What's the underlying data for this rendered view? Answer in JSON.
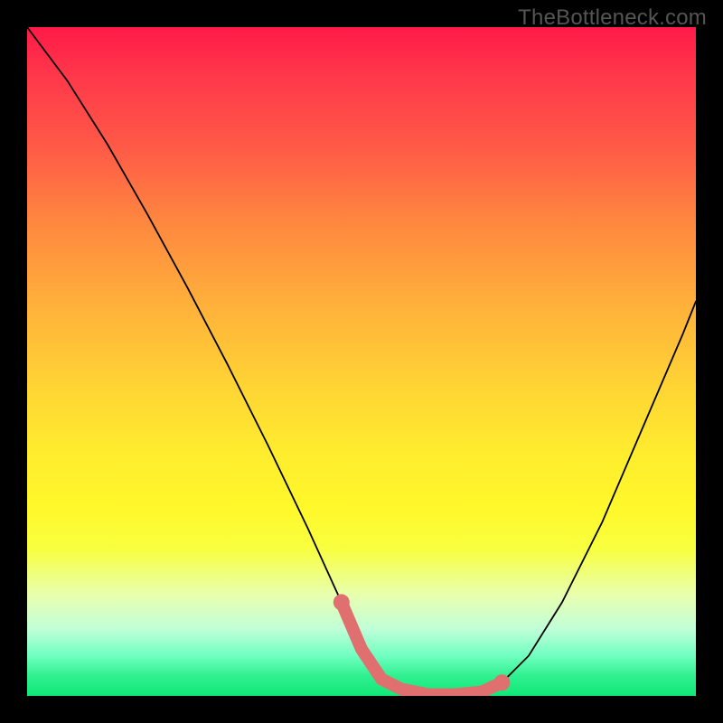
{
  "watermark": "TheBottleneck.com",
  "chart_data": {
    "type": "line",
    "title": "",
    "xlabel": "",
    "ylabel": "",
    "xlim": [
      0,
      100
    ],
    "ylim": [
      0,
      100
    ],
    "grid": false,
    "series": [
      {
        "name": "curve",
        "x": [
          0,
          6,
          12,
          18,
          24,
          30,
          36,
          42,
          47,
          50,
          53,
          56,
          60,
          64,
          68,
          71,
          75,
          80,
          86,
          92,
          98,
          100
        ],
        "values": [
          100,
          92,
          82.5,
          72,
          61,
          49.5,
          37.5,
          25,
          14,
          7,
          2.5,
          1,
          0.2,
          0.2,
          0.6,
          2,
          6,
          14,
          26,
          40,
          54,
          59
        ]
      }
    ],
    "markers": {
      "name": "flat-region",
      "color": "#e07070",
      "x": [
        47,
        50,
        53,
        56,
        60,
        64,
        68,
        71
      ],
      "values": [
        14,
        7,
        2.5,
        1,
        0.2,
        0.2,
        0.6,
        2
      ]
    },
    "background_gradient": {
      "top_color": "#ff1a48",
      "mid_color": "#ffed2e",
      "bottom_color": "#10e878"
    }
  }
}
